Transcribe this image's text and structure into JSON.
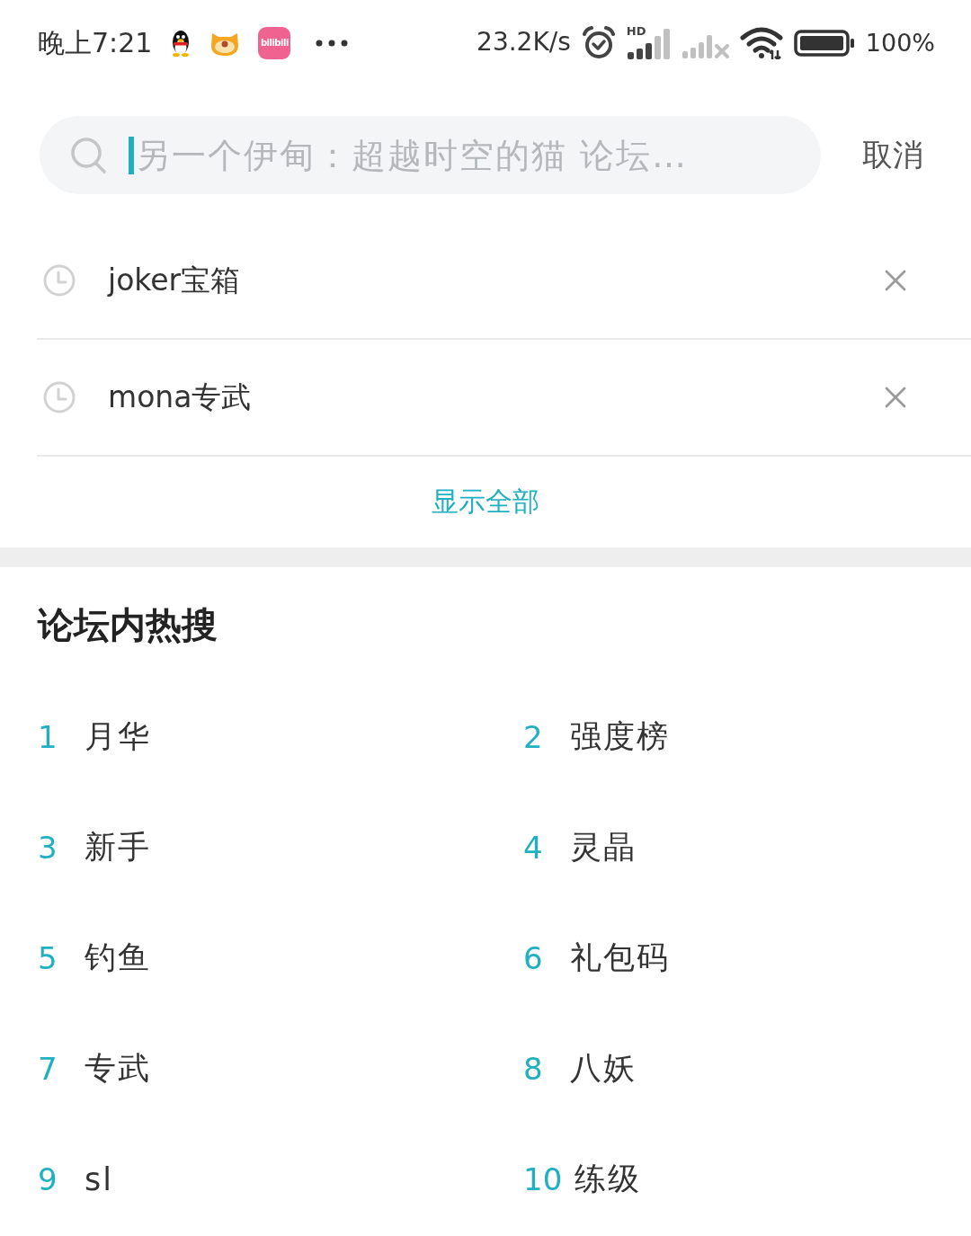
{
  "status_bar": {
    "time": "晚上7:21",
    "notifications": [
      {
        "kind": "qq"
      },
      {
        "kind": "cat"
      },
      {
        "kind": "app",
        "label": "bilibili"
      }
    ],
    "net_speed": "23.2K/s",
    "network_label": "HD",
    "battery": "100%"
  },
  "search": {
    "placeholder": "另一个伊甸：超越时空的猫 论坛…",
    "focused": true,
    "cancel": "取消"
  },
  "history": [
    {
      "text": "joker宝箱"
    },
    {
      "text": "mona专武"
    }
  ],
  "show_all": "显示全部",
  "hot": {
    "title": "论坛内热搜",
    "items": [
      {
        "rank": "1",
        "text": "月华"
      },
      {
        "rank": "2",
        "text": "强度榜"
      },
      {
        "rank": "3",
        "text": "新手"
      },
      {
        "rank": "4",
        "text": "灵晶"
      },
      {
        "rank": "5",
        "text": "钓鱼"
      },
      {
        "rank": "6",
        "text": "礼包码"
      },
      {
        "rank": "7",
        "text": "专武"
      },
      {
        "rank": "8",
        "text": "八妖"
      },
      {
        "rank": "9",
        "text": "sl"
      },
      {
        "rank": "10",
        "text": "练级"
      }
    ]
  }
}
